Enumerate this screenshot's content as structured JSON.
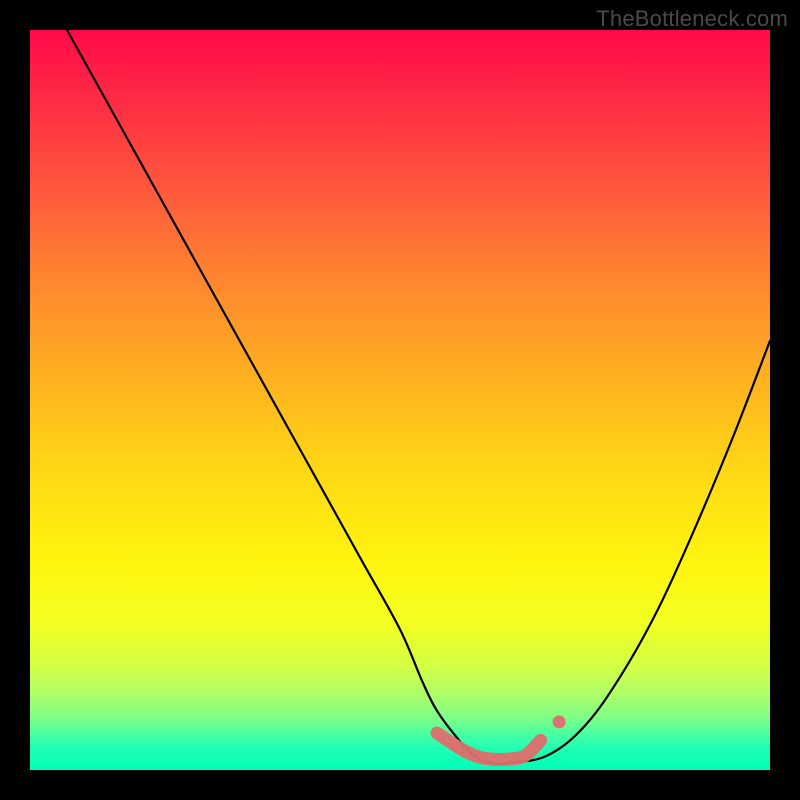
{
  "watermark": "TheBottleneck.com",
  "chart_data": {
    "type": "line",
    "title": "",
    "xlabel": "",
    "ylabel": "",
    "xlim": [
      0,
      100
    ],
    "ylim": [
      0,
      100
    ],
    "series": [
      {
        "name": "bottleneck-curve",
        "x": [
          5,
          10,
          15,
          20,
          25,
          30,
          35,
          40,
          45,
          50,
          53,
          55,
          58,
          60,
          62,
          65,
          70,
          75,
          80,
          85,
          90,
          95,
          100
        ],
        "y": [
          100,
          91,
          82,
          73,
          64,
          55,
          46,
          37,
          28,
          19,
          12,
          8,
          4,
          2,
          1,
          1,
          2,
          6,
          13,
          22,
          33,
          45,
          58
        ]
      }
    ],
    "highlight_segment": {
      "name": "optimal-range",
      "x": [
        55,
        58,
        60,
        62,
        65,
        67,
        69
      ],
      "y": [
        5,
        3,
        2,
        1.5,
        1.5,
        2,
        4
      ]
    }
  }
}
